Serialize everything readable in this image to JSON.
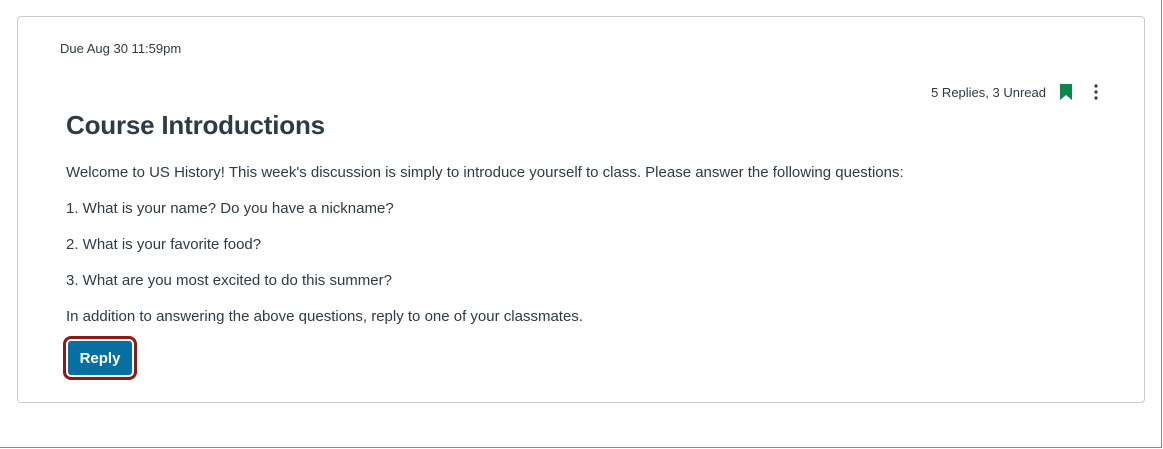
{
  "topic": {
    "due": "Due Aug 30 11:59pm",
    "counts": "5 Replies, 3 Unread",
    "title": "Course Introductions",
    "paragraphs": [
      "Welcome to US History! This week's discussion is simply to introduce yourself to class. Please answer the following questions:",
      "1. What is your name? Do you have a nickname?",
      "2. What is your favorite food?",
      "3. What are you most excited to do this summer?",
      "In addition to answering the above questions, reply to one of your classmates."
    ],
    "reply_label": "Reply"
  },
  "icons": {
    "bookmark": "bookmark-icon",
    "options": "kebab-menu-icon"
  },
  "colors": {
    "accent": "#0770a3",
    "bookmark": "#0b874b",
    "focus_ring": "#8b1a1a",
    "text": "#2d3b45"
  }
}
